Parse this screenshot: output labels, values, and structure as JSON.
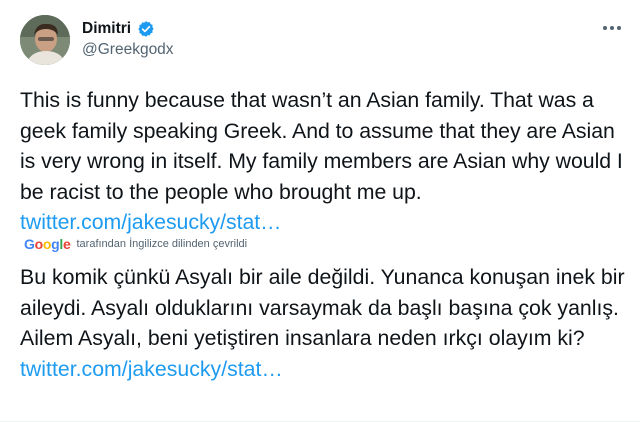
{
  "user": {
    "display_name": "Dimitri",
    "handle": "@Greekgodx"
  },
  "tweet": {
    "text": "This is funny because that wasn’t an Asian family. That was a geek family speaking Greek. And  to assume that they are Asian is very wrong in itself. My family members are Asian why would I be racist to the people who brought me up. ",
    "link": "twitter.com/jakesucky/stat…"
  },
  "translation": {
    "logo_letters": [
      "G",
      "o",
      "o",
      "g",
      "l",
      "e"
    ],
    "caption": "tarafından İngilizce dilinden çevrildi",
    "text": "Bu komik çünkü Asyalı bir aile değildi. Yunanca konuşan inek bir aileydi. Asyalı olduklarını varsaymak da başlı başına çok yanlış. Ailem Asyalı, beni yetiştiren insanlara neden ırkçı olayım ki?",
    "link": "twitter.com/jakesucky/stat…"
  },
  "icons": {
    "verified": "verified-badge-icon",
    "more": "more-options-icon"
  },
  "colors": {
    "link": "#1d9bf0",
    "verified": "#1d9bf0",
    "secondary_text": "#536471",
    "primary_text": "#0f1419"
  }
}
